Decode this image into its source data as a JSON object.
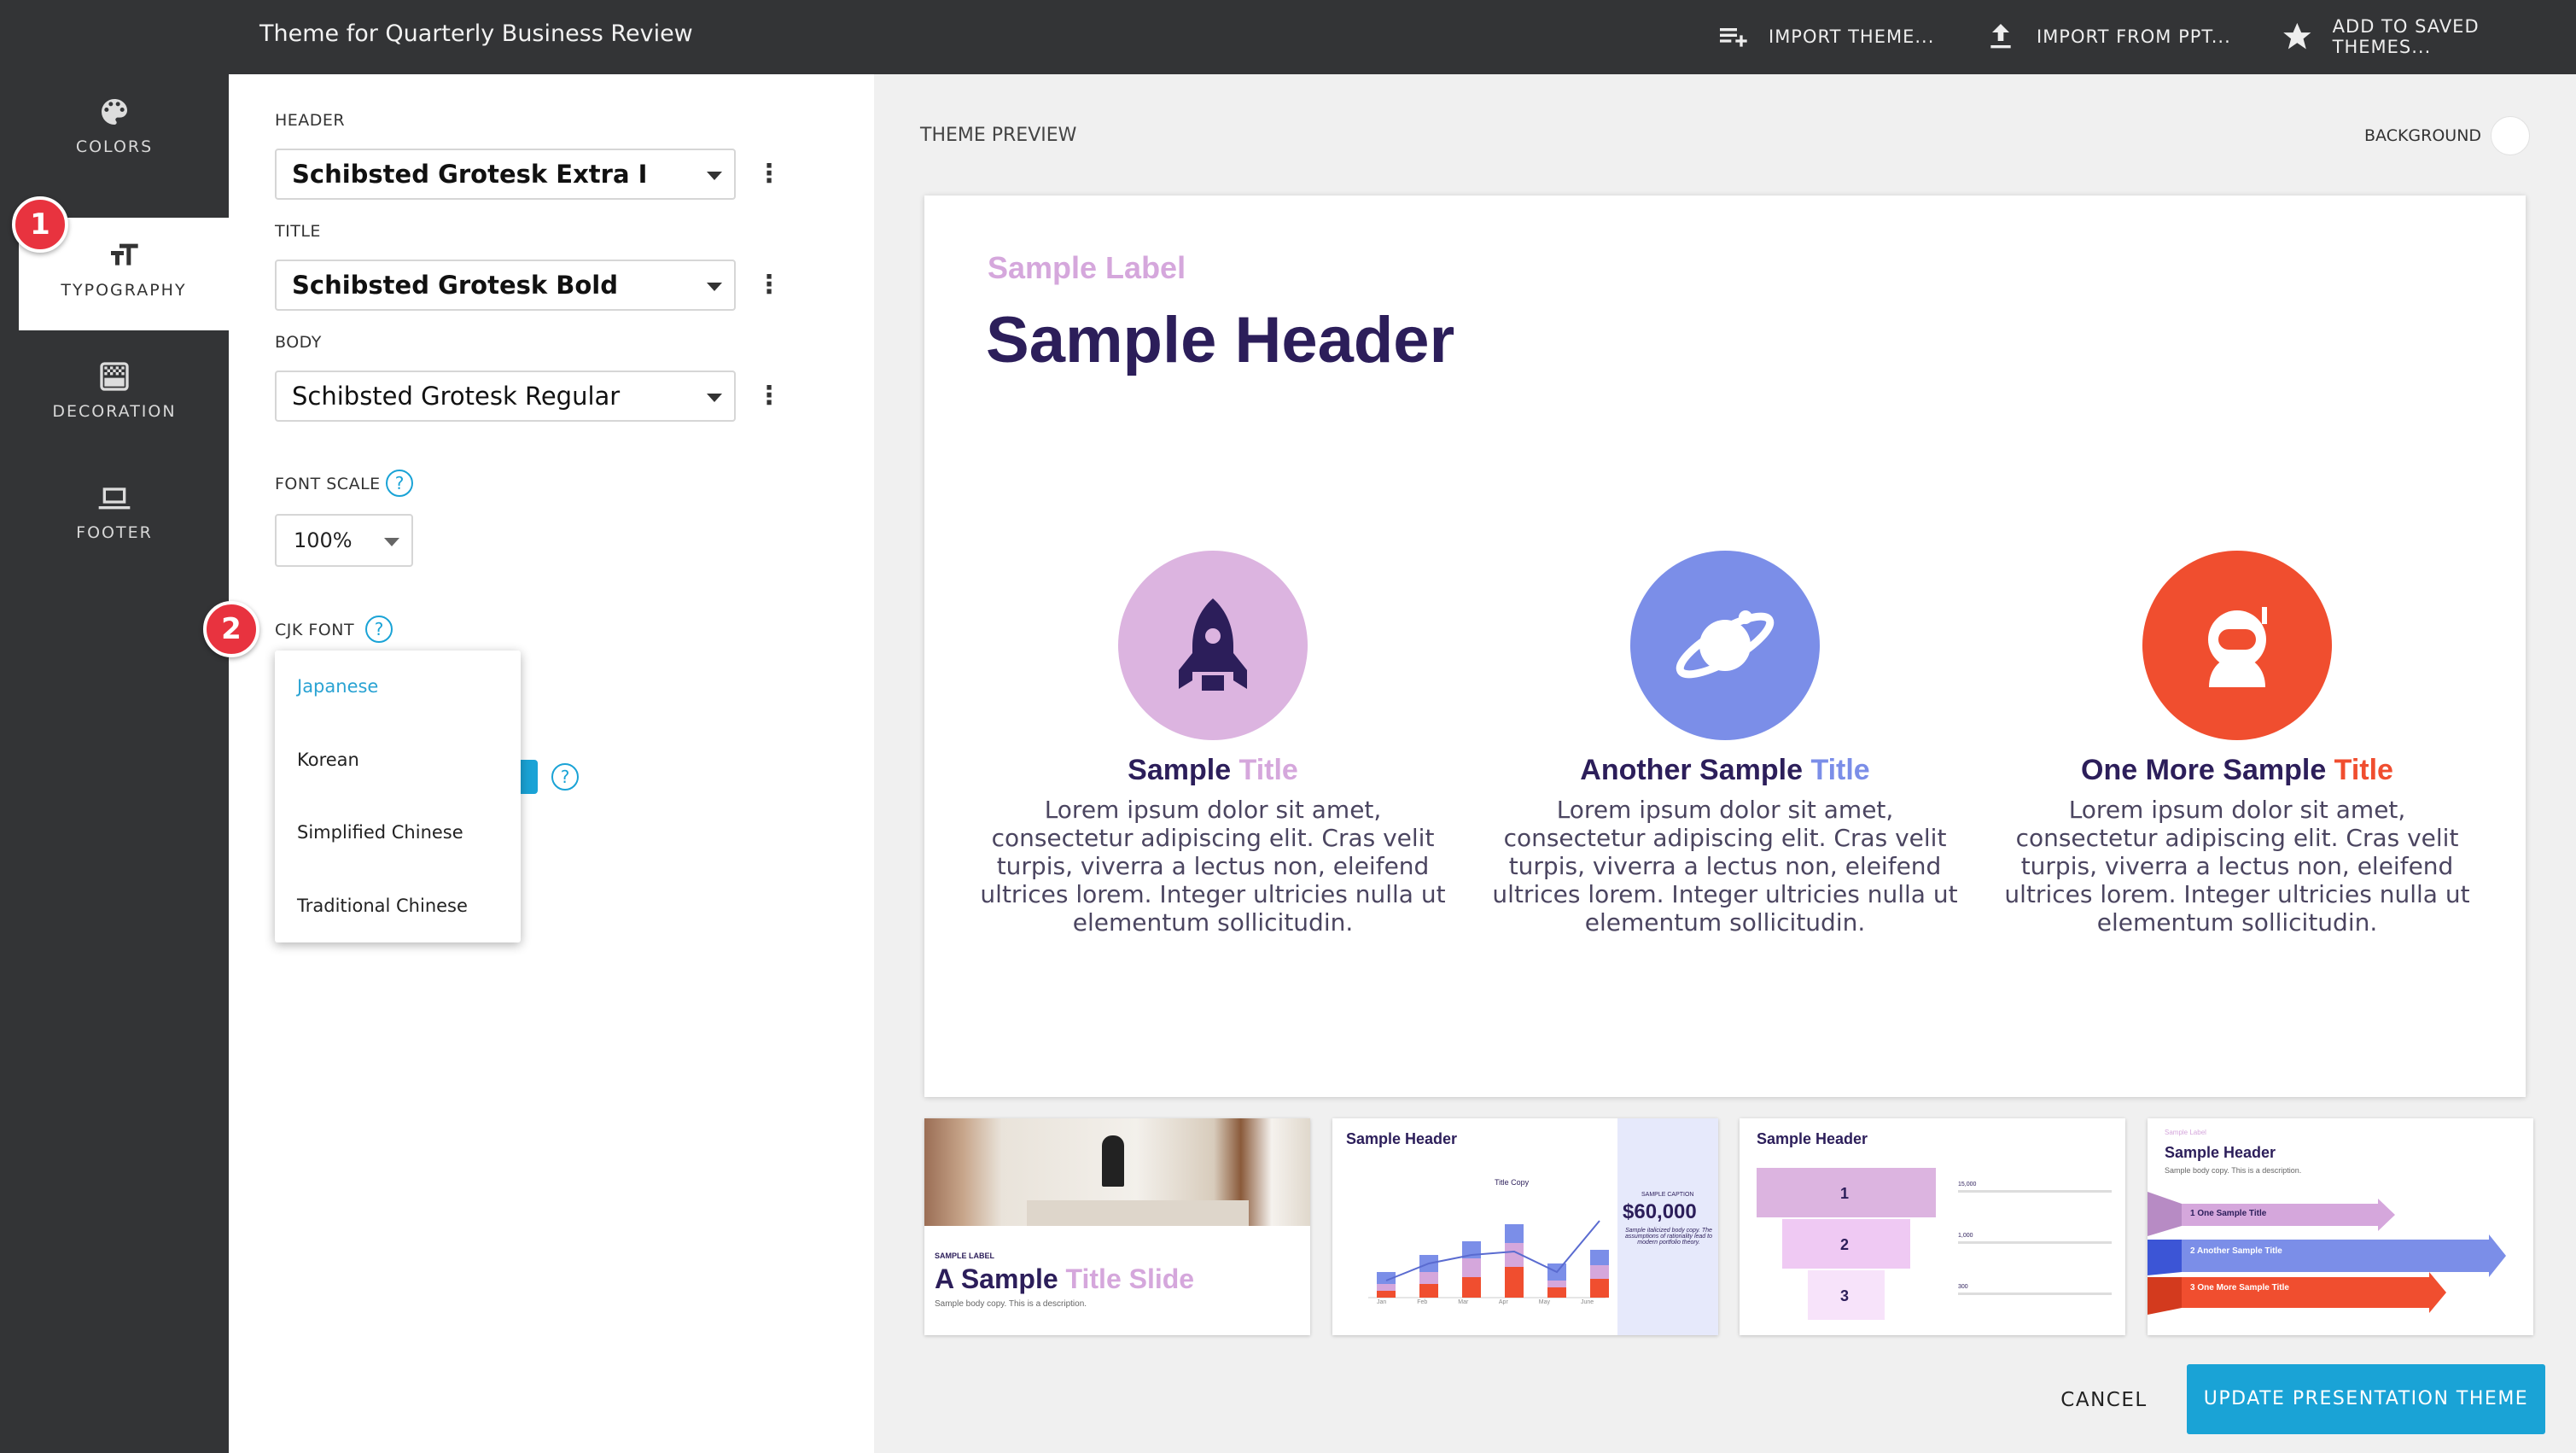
{
  "app": {
    "title": "Theme for Quarterly Business Review"
  },
  "topbar": {
    "import_theme": "IMPORT THEME...",
    "import_ppt": "IMPORT FROM PPT...",
    "add_saved": "ADD TO SAVED THEMES..."
  },
  "sidebar": {
    "items": [
      {
        "label": "COLORS",
        "icon": "palette-icon"
      },
      {
        "label": "TYPOGRAPHY",
        "icon": "text-size-icon"
      },
      {
        "label": "DECORATION",
        "icon": "decoration-icon"
      },
      {
        "label": "FOOTER",
        "icon": "laptop-icon"
      }
    ],
    "active": "TYPOGRAPHY"
  },
  "steps": {
    "one": "1",
    "two": "2"
  },
  "typography": {
    "header_label": "HEADER",
    "header_font": "Schibsted Grotesk Extra I",
    "title_label": "TITLE",
    "title_font": "Schibsted Grotesk Bold",
    "body_label": "BODY",
    "body_font": "Schibsted Grotesk Regular",
    "font_scale_label": "FONT SCALE",
    "font_scale_value": "100%",
    "cjk_label": "CJK FONT",
    "cjk_options": [
      "Japanese",
      "Korean",
      "Simplified Chinese",
      "Traditional Chinese"
    ],
    "cjk_selected": "Japanese",
    "help_glyph": "?"
  },
  "preview": {
    "label": "THEME PREVIEW",
    "background_label": "BACKGROUND",
    "slide": {
      "sample_label": "Sample Label",
      "sample_header": "Sample Header",
      "columns": [
        {
          "title_main": "Sample ",
          "title_accent": "Title",
          "accent": "#d5a7dc",
          "circle": "#dcb4e0",
          "icon": "rocket-icon",
          "body": "Lorem ipsum dolor sit amet, consectetur adipiscing elit. Cras velit turpis, viverra a lectus non, eleifend ultrices lorem. Integer ultricies nulla ut elementum sollicitudin."
        },
        {
          "title_main": "Another Sample ",
          "title_accent": "Title",
          "accent": "#7b8ee8",
          "circle": "#7b8ee8",
          "icon": "planet-icon",
          "body": "Lorem ipsum dolor sit amet, consectetur adipiscing elit. Cras velit turpis, viverra a lectus non, eleifend ultrices lorem. Integer ultricies nulla ut elementum sollicitudin."
        },
        {
          "title_main": "One More Sample ",
          "title_accent": "Title",
          "accent": "#f04e2f",
          "circle": "#f04e2f",
          "icon": "astronaut-icon",
          "body": "Lorem ipsum dolor sit amet, consectetur adipiscing elit. Cras velit turpis, viverra a lectus non, eleifend ultrices lorem. Integer ultricies nulla ut elementum sollicitudin."
        }
      ]
    },
    "thumbs": {
      "t1": {
        "label": "SAMPLE LABEL",
        "title_main": "A Sample ",
        "title_accent": "Title Slide",
        "desc": "Sample body copy. This is a description."
      },
      "t2": {
        "header": "Sample Header",
        "chart_title": "Title Copy",
        "caption": "SAMPLE CAPTION",
        "value": "$60,000",
        "note": "Sample italicized body copy. The assumptions of rationality lead to modern portfolio theory.",
        "months": [
          "Jan",
          "Feb",
          "Mar",
          "Apr",
          "May",
          "June"
        ]
      },
      "t3": {
        "header": "Sample Header",
        "steps": [
          "1",
          "2",
          "3"
        ],
        "values": [
          "15,000",
          "1,000",
          "300"
        ]
      },
      "t4": {
        "label": "Sample Label",
        "header": "Sample Header",
        "desc": "Sample body copy. This is a description.",
        "arrows": [
          "1  One Sample Title",
          "2  Another Sample Title",
          "3  One More Sample Title"
        ]
      }
    }
  },
  "actions": {
    "cancel": "CANCEL",
    "update": "UPDATE PRESENTATION THEME"
  },
  "colors": {
    "accent": "#1aa3d6",
    "badge": "#e8333f",
    "navy": "#2c1e5a"
  }
}
